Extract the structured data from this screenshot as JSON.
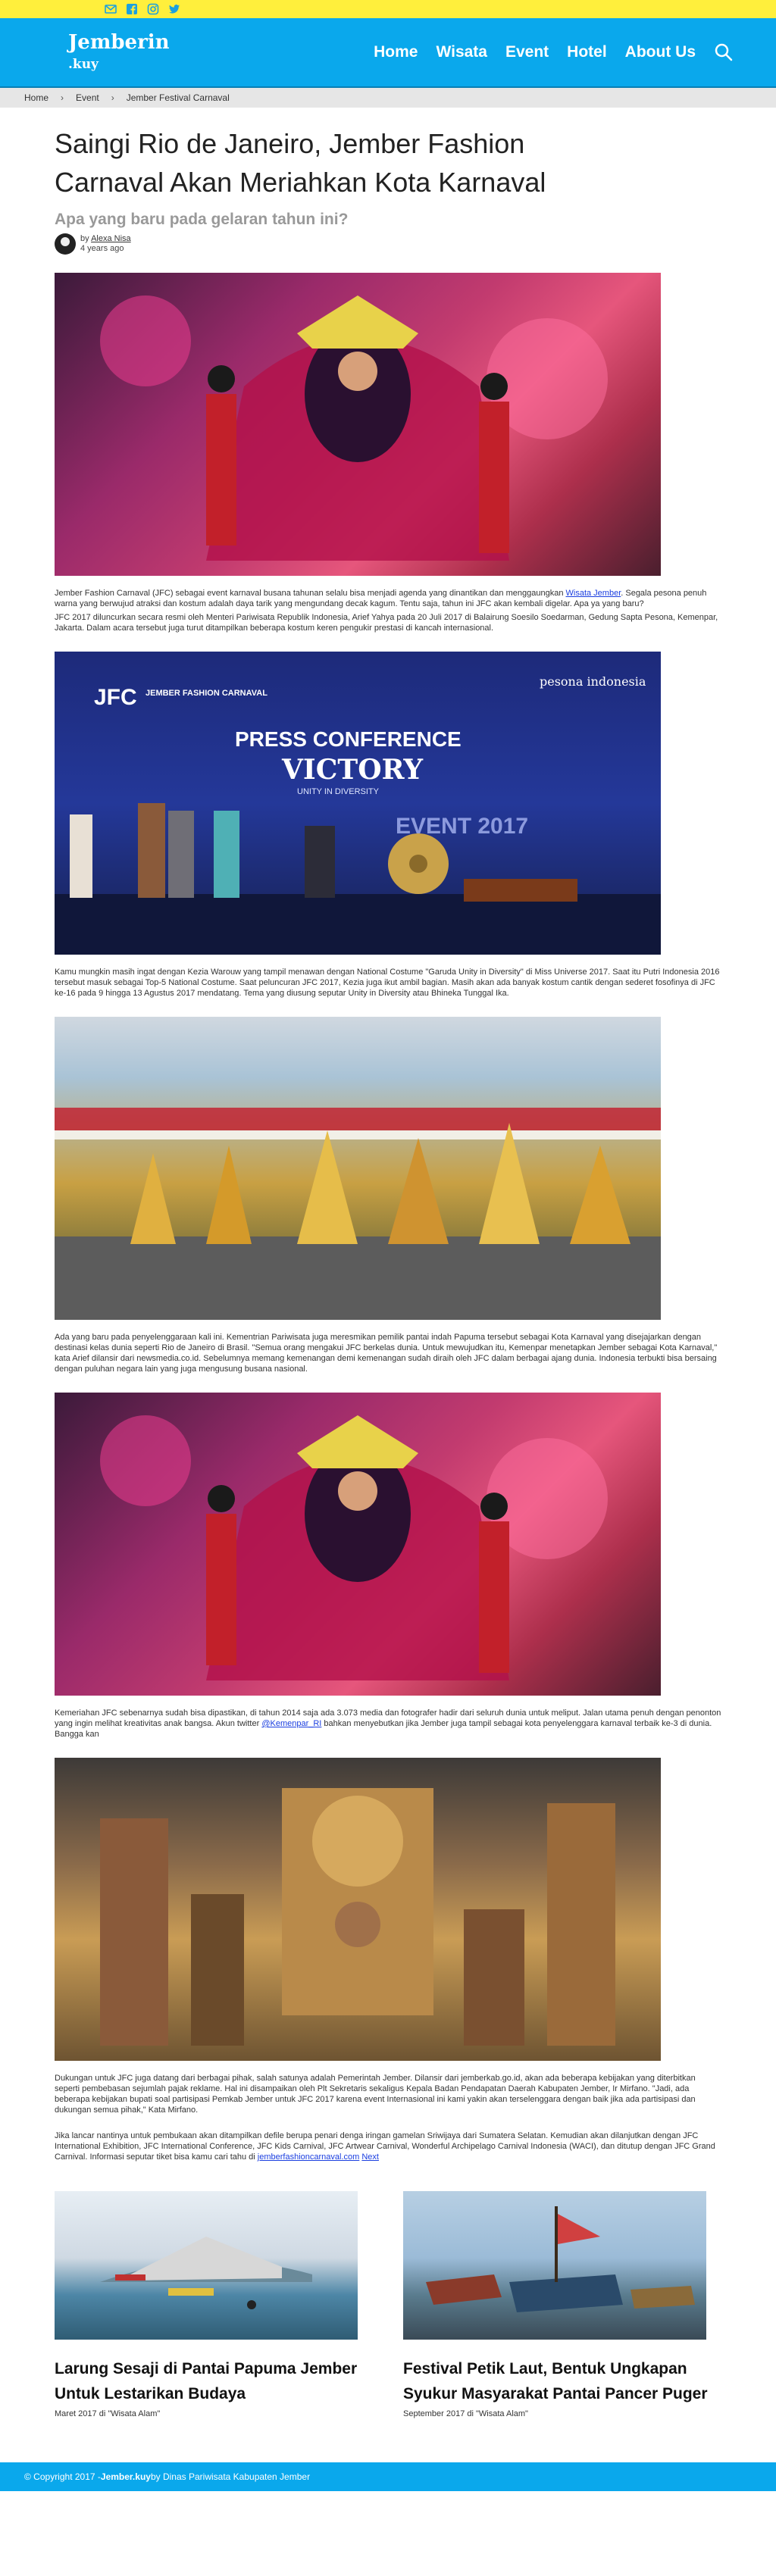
{
  "social": [
    "email-icon",
    "facebook-icon",
    "instagram-icon",
    "twitter-icon"
  ],
  "logo": {
    "line1": "Jemberin",
    "line2": ".kuy"
  },
  "nav": {
    "home": "Home",
    "wisata": "Wisata",
    "event": "Event",
    "hotel": "Hotel",
    "about": "About Us"
  },
  "breadcrumb": {
    "home": "Home",
    "event": "Event",
    "current": "Jember Festival Carnaval"
  },
  "article": {
    "title": "Saingi Rio de Janeiro, Jember Fashion Carnaval Akan Meriahkan Kota Karnaval",
    "subtitle": "Apa yang baru pada gelaran tahun ini?",
    "author_prefix": "by",
    "author": "Alexa Nisa",
    "age": "4 years ago",
    "p1a": "Jember Fashion Carnaval (JFC) sebagai event karnaval busana  tahunan selalu bisa menjadi agenda yang dinantikan dan menggaungkan ",
    "p1link": "Wisata Jember",
    "p1b": ". Segala pesona penuh warna yang berwujud atraksi dan kostum adalah daya tarik yang mengundang decak kagum. Tentu saja, tahun ini JFC akan kembali digelar. Apa ya yang baru?",
    "p2": "JFC  2017 diluncurkan secara resmi oleh Menteri Pariwisata Republik Indonesia, Arief Yahya pada  20 Juli 2017 di Balairung Soesilo Soedarman, Gedung Sapta Pesona, Kemenpar, Jakarta. Dalam acara tersebut juga turut ditampilkan beberapa kostum keren pengukir prestasi di kancah internasional.",
    "p3": "    Kamu mungkin masih ingat dengan Kezia Warouw yang tampil menawan dengan National Costume \"Garuda Unity in Diversity\" di Miss Universe 2017. Saat itu Putri Indonesia 2016 tersebut masuk sebagai Top-5 National Costume. Saat peluncuran JFC 2017, Kezia juga ikut ambil bagian.  Masih akan ada banyak kostum cantik dengan sederet fosofinya di JFC ke-16 pada 9 hingga 13 Agustus 2017 mendatang. Tema yang diusung seputar Unity in Diversity atau Bhineka Tunggal Ika.",
    "p4": "    Ada yang baru pada penyelenggaraan kali ini. Kementrian Pariwisata juga meresmikan pemilik pantai indah Papuma tersebut sebagai Kota Karnaval yang disejajarkan dengan destinasi kelas dunia seperti Rio de Janeiro di Brasil. \"Semua orang mengakui JFC berkelas dunia. Untuk mewujudkan itu, Kemenpar menetapkan Jember sebagai Kota Karnaval,\" kata Arief dilansir dari newsmedia.co.id. Sebelumnya memang kemenangan demi kemenangan sudah diraih oleh JFC dalam berbagai ajang dunia. Indonesia terbukti bisa bersaing dengan puluhan negara lain yang juga mengusung busana nasional.",
    "p5a": "    Kemeriahan JFC sebenarnya sudah bisa dipastikan, di tahun 2014 saja ada 3.073 media dan fotografer hadir dari seluruh dunia untuk meliput. Jalan utama penuh dengan penonton yang ingin melihat kreativitas anak bangsa. Akun twitter ",
    "p5link": "@Kemenpar_RI",
    "p5b": " bahkan menyebutkan jika Jember juga tampil sebagai kota penyelenggara karnaval terbaik ke-3 di dunia. Bangga kan",
    "p6": "    Dukungan untuk JFC juga datang dari berbagai pihak, salah satunya adalah Pemerintah Jember. Dilansir dari jemberkab.go.id, akan ada beberapa kebijakan yang diterbitkan seperti pembebasan sejumlah pajak reklame. Hal ini disampaikan oleh Plt Sekretaris sekaligus Kepala Badan Pendapatan Daerah Kabupaten Jember, Ir Mirfano. \"Jadi, ada beberapa kebijakan bupati soal partisipasi Pemkab Jember untuk JFC 2017 karena event Internasional ini kami yakin akan terselenggara dengan baik jika ada partisipasi dan dukungan semua pihak,\" Kata Mirfano.",
    "p7a": "    Jika lancar nantinya untuk pembukaan akan ditampilkan defile berupa penari denga iringan gamelan Sriwijaya dari Sumatera Selatan. Kemudian akan dilanjutkan dengan JFC International Exhibition, JFC International Conference, JFC Kids Carnival, JFC Artwear  Carnival, Wonderful Archipelago Carnival Indonesia (WACI), dan ditutup dengan JFC Grand Carnival. Informasi seputar tiket bisa kamu cari tahu di ",
    "p7link": "jemberfashioncarnaval.com",
    "p7next": "Next",
    "photo2_banner": "PRESS CONFERENCE",
    "photo2_victory": "VICTORY",
    "photo2_unity": "UNITY IN DIVERSITY",
    "photo2_logo": "JEMBER FASHION CARNAVAL",
    "photo2_logo_short": "JFC",
    "photo2_pesona": "pesona indonesia",
    "photo2_year": "EVENT 2017"
  },
  "related": [
    {
      "title": "Larung Sesaji di Pantai Papuma Jember Untuk Lestarikan Budaya",
      "date": "Maret 2017 di \"Wisata Alam\""
    },
    {
      "title": "Festival Petik Laut, Bentuk Ungkapan Syukur Masyarakat Pantai Pancer Puger",
      "date": "September 2017 di \"Wisata Alam\""
    }
  ],
  "footer": {
    "copyright": "© Copyright 2017 - ",
    "site": "Jember.kuy",
    "by": " by Dinas Pariwisata Kabupaten Jember"
  }
}
